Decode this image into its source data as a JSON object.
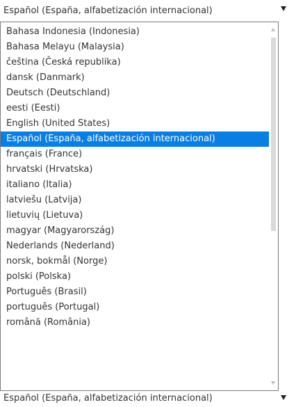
{
  "select": {
    "value": "Español (España, alfabetización internacional)",
    "arrow_icon": "triangle-down-icon"
  },
  "dropdown": {
    "items": [
      {
        "label": "Bahasa Indonesia (Indonesia)"
      },
      {
        "label": "Bahasa Melayu (Malaysia)"
      },
      {
        "label": "čeština (Česká republika)"
      },
      {
        "label": "dansk (Danmark)"
      },
      {
        "label": "Deutsch (Deutschland)"
      },
      {
        "label": "eesti (Eesti)"
      },
      {
        "label": "English (United States)"
      },
      {
        "label": "Español (España, alfabetización internacional)",
        "selected": true
      },
      {
        "label": "français (France)"
      },
      {
        "label": "hrvatski (Hrvatska)"
      },
      {
        "label": "italiano (Italia)"
      },
      {
        "label": "latviešu (Latvija)"
      },
      {
        "label": "lietuvių (Lietuva)"
      },
      {
        "label": "magyar (Magyarország)"
      },
      {
        "label": "Nederlands (Nederland)"
      },
      {
        "label": "norsk, bokmål (Norge)"
      },
      {
        "label": "polski (Polska)"
      },
      {
        "label": "Português (Brasil)"
      },
      {
        "label": "português (Portugal)"
      },
      {
        "label": "română (România)"
      }
    ],
    "selected_color": "#0a7fe3"
  }
}
